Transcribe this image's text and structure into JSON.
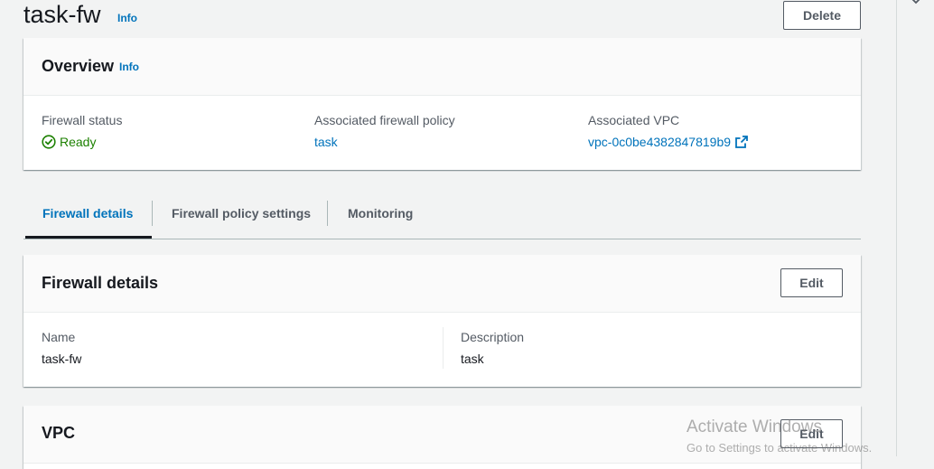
{
  "page": {
    "title": "task-fw",
    "info_label": "Info",
    "delete_label": "Delete"
  },
  "overview": {
    "title": "Overview",
    "info_label": "Info",
    "firewall_status_label": "Firewall status",
    "firewall_status_value": "Ready",
    "policy_label": "Associated firewall policy",
    "policy_value": "task",
    "vpc_label": "Associated VPC",
    "vpc_value": "vpc-0c0be4382847819b9"
  },
  "tabs": [
    {
      "label": "Firewall details",
      "active": true
    },
    {
      "label": "Firewall policy settings",
      "active": false
    },
    {
      "label": "Monitoring",
      "active": false
    }
  ],
  "details": {
    "title": "Firewall details",
    "edit_label": "Edit",
    "name_label": "Name",
    "name_value": "task-fw",
    "description_label": "Description",
    "description_value": "task"
  },
  "vpc_section": {
    "title": "VPC",
    "edit_label": "Edit"
  },
  "watermark": {
    "line1": "Activate Windows",
    "line2": "Go to Settings to activate Windows."
  },
  "colors": {
    "link": "#0073bb",
    "success": "#1d8102",
    "background": "#f2f3f3"
  }
}
